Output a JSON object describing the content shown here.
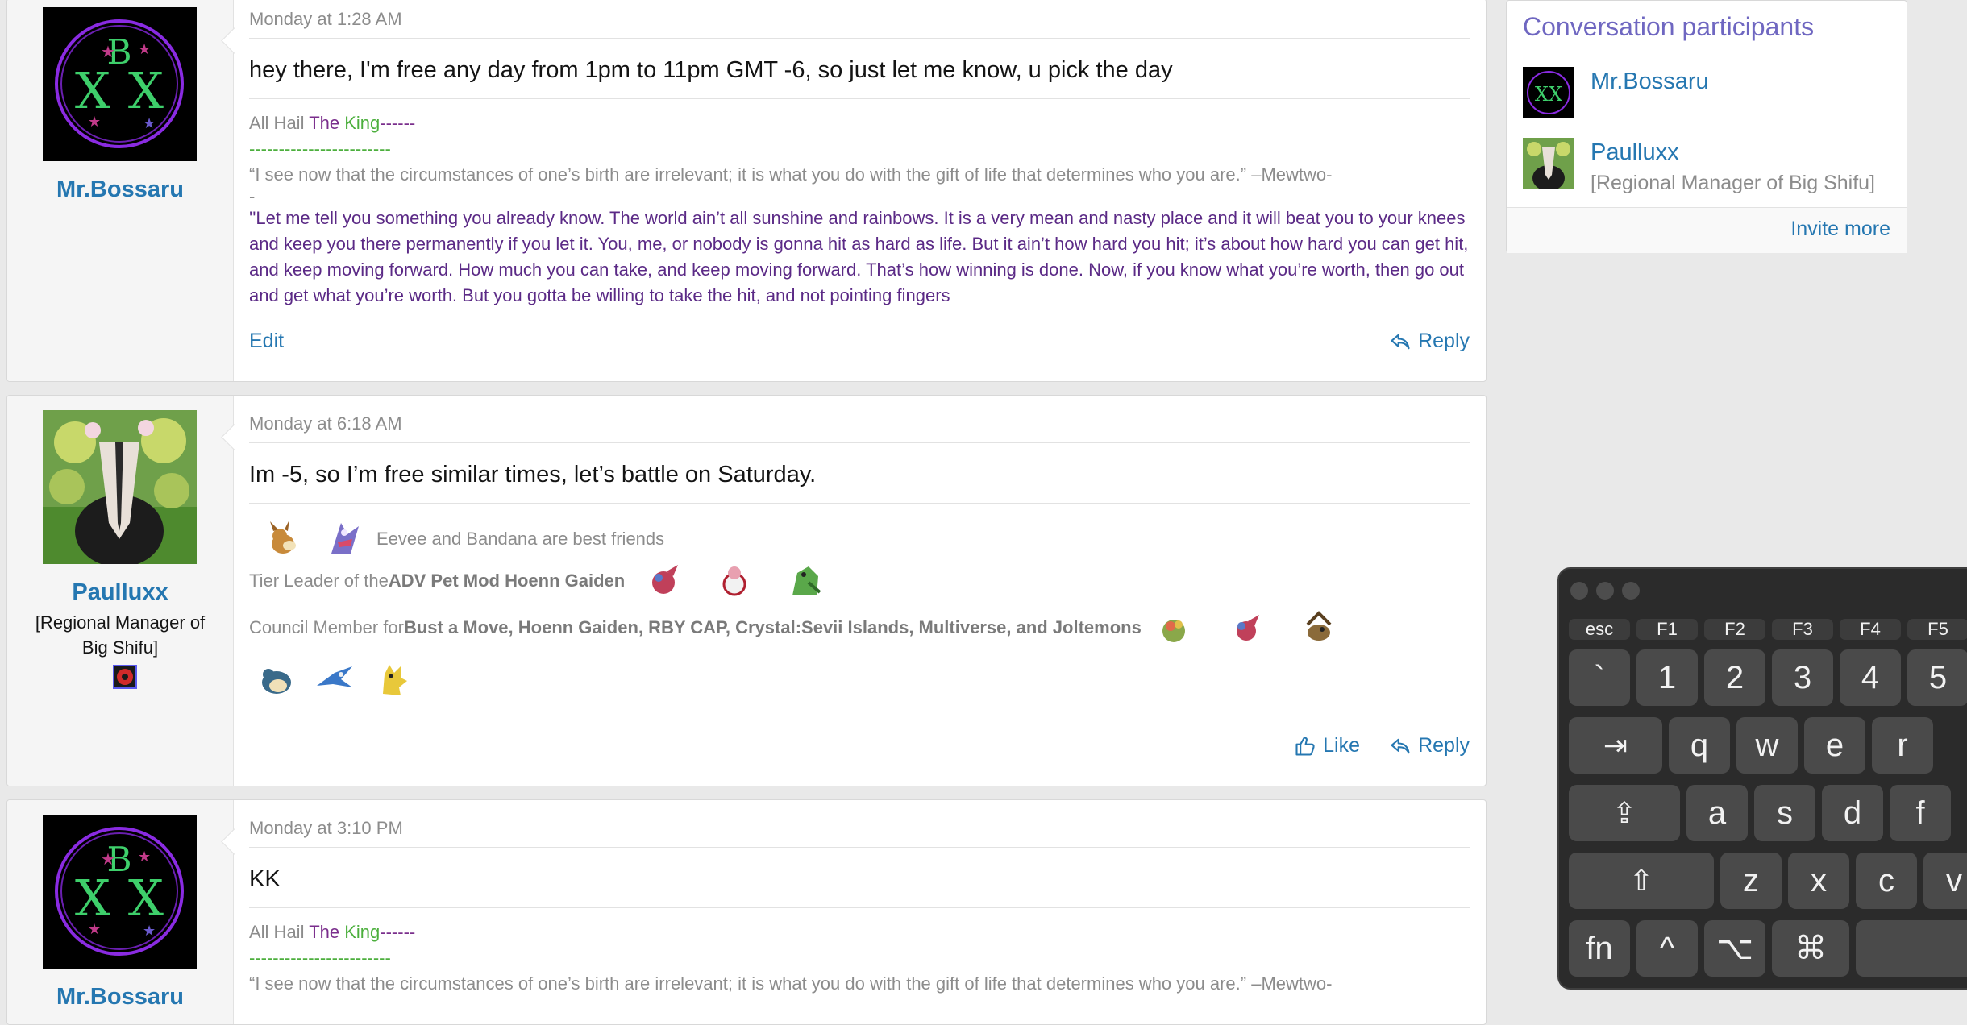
{
  "messages": [
    {
      "user": {
        "name": "Mr.Bossaru"
      },
      "timestamp": "Monday at 1:28 AM",
      "body": "hey there, I'm free any day from 1pm to 11pm GMT -6, so just let me know, u pick the day",
      "signature": {
        "prefix": "All Hail ",
        "the": "The",
        "king": "King",
        "trail": "------",
        "dashes": "------------------------",
        "quote1": "“I see now that the circumstances of one’s birth are irrelevant; it is what you do with the gift of life that determines who you are.” –Mewtwo-",
        "quote1_cont": "-",
        "quote2": "''Let me tell you something you already know. The world ain’t all sunshine and rainbows. It is a very mean and nasty place and it will beat you to your knees and keep you there permanently if you let it. You, me, or nobody is gonna hit as hard as life. But it ain’t how hard you hit; it’s about how hard you can get hit, and keep moving forward. How much you can take, and keep moving forward. That’s how winning is done. Now, if you know what you’re worth, then go out and get what you’re worth. But you gotta be willing to take the hit, and not pointing fingers"
      },
      "actions": {
        "edit": "Edit",
        "reply": "Reply"
      }
    },
    {
      "user": {
        "name": "Paulluxx",
        "title": "[Regional Manager of Big Shifu]"
      },
      "timestamp": "Monday at 6:18 AM",
      "body": "Im -5, so I’m free similar times, let’s battle on Saturday.",
      "signature": {
        "line1": "Eevee and Bandana are best friends",
        "line2_prefix": "Tier Leader of the ",
        "line2_bold": "ADV Pet Mod Hoenn Gaiden",
        "line3_prefix": "Council Member for ",
        "line3_bold": "Bust a Move, Hoenn Gaiden, RBY CAP, Crystal:Sevii Islands, Multiverse, and Joltemons"
      },
      "actions": {
        "like": "Like",
        "reply": "Reply"
      }
    },
    {
      "user": {
        "name": "Mr.Bossaru"
      },
      "timestamp": "Monday at 3:10 PM",
      "body": "KK",
      "signature": {
        "prefix": "All Hail ",
        "the": "The",
        "king": "King",
        "trail": "------",
        "dashes": "------------------------",
        "quote1": "“I see now that the circumstances of one’s birth are irrelevant; it is what you do with the gift of life that determines who you are.” –Mewtwo-"
      }
    }
  ],
  "sidebar": {
    "title": "Conversation participants",
    "participants": [
      {
        "name": "Mr.Bossaru"
      },
      {
        "name": "Paulluxx",
        "title": "[Regional Manager of Big Shifu]"
      }
    ],
    "invite": "Invite more"
  },
  "keyboard": {
    "fn_row": [
      "esc",
      "F1",
      "F2",
      "F3",
      "F4",
      "F5"
    ],
    "row1": [
      "`",
      "1",
      "2",
      "3",
      "4",
      "5"
    ],
    "row2": [
      "⇥",
      "q",
      "w",
      "e",
      "r"
    ],
    "row3": [
      "⇪",
      "a",
      "s",
      "d",
      "f"
    ],
    "row4": [
      "⇧",
      "z",
      "x",
      "c",
      "v"
    ],
    "row5": [
      "fn",
      "^",
      "⌥",
      "⌘"
    ]
  },
  "colors": {
    "link": "#2577b1",
    "sidebar_title": "#6f67c1",
    "signature_purple": "#7a2e8c",
    "signature_green": "#4caf3d"
  }
}
